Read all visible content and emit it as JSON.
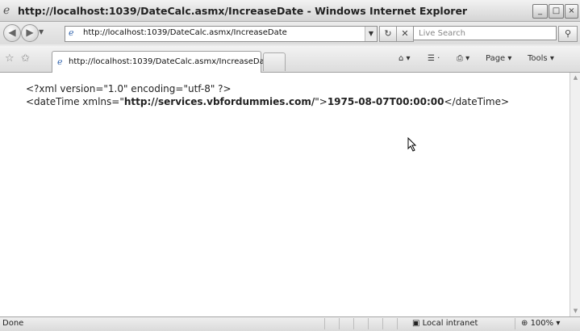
{
  "window": {
    "title": "http://localhost:1039/DateCalc.asmx/IncreaseDate - Windows Internet Explorer",
    "min": "_",
    "max": "□",
    "close": "×"
  },
  "address": {
    "url": "http://localhost:1039/DateCalc.asmx/IncreaseDate",
    "search_placeholder": "Live Search"
  },
  "tab": {
    "label": "http://localhost:1039/DateCalc.asmx/IncreaseDate"
  },
  "commands": {
    "page": "Page ▾",
    "tools": "Tools ▾"
  },
  "xml": {
    "declaration": "<?xml version=\"1.0\" encoding=\"utf-8\" ?>",
    "open_tag_start": "<dateTime xmlns=\"",
    "namespace": "http://services.vbfordummies.com/",
    "open_tag_end": "\">",
    "value": "1975-08-07T00:00:00",
    "close_tag": "</dateTime>"
  },
  "status": {
    "text": "Done",
    "zone": "Local intranet",
    "zoom": "100%"
  }
}
